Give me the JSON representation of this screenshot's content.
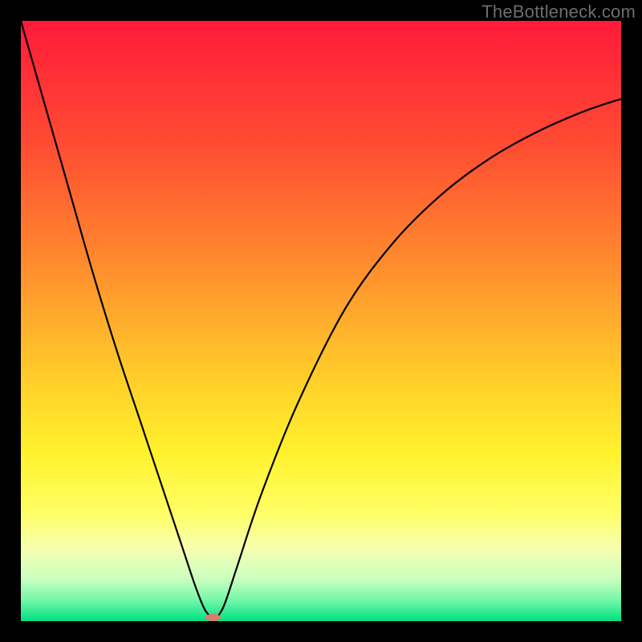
{
  "watermark": "TheBottleneck.com",
  "chart_data": {
    "type": "line",
    "title": "",
    "xlabel": "",
    "ylabel": "",
    "xlim": [
      0,
      100
    ],
    "ylim": [
      0,
      100
    ],
    "background": {
      "type": "vertical-gradient",
      "stops": [
        {
          "pos": 0.0,
          "color": "#ff1a3a"
        },
        {
          "pos": 0.2,
          "color": "#ff4a32"
        },
        {
          "pos": 0.4,
          "color": "#ff8a2e"
        },
        {
          "pos": 0.58,
          "color": "#ffc92a"
        },
        {
          "pos": 0.72,
          "color": "#fff22c"
        },
        {
          "pos": 0.82,
          "color": "#ffff66"
        },
        {
          "pos": 0.88,
          "color": "#f6ffb0"
        },
        {
          "pos": 0.93,
          "color": "#c9ffc0"
        },
        {
          "pos": 0.965,
          "color": "#74f7a8"
        },
        {
          "pos": 1.0,
          "color": "#00e082"
        }
      ]
    },
    "series": [
      {
        "name": "bottleneck-curve",
        "color": "#000000",
        "x": [
          0,
          4,
          8,
          12,
          16,
          20,
          24,
          27,
          29,
          30.5,
          31.5,
          32,
          32.8,
          34,
          36,
          40,
          46,
          54,
          62,
          70,
          78,
          86,
          94,
          100
        ],
        "y": [
          100,
          86,
          72,
          58,
          45,
          33,
          21,
          12,
          6,
          2.2,
          0.8,
          0.4,
          0.8,
          3,
          9,
          21,
          36,
          52,
          63,
          71,
          77,
          81.5,
          85,
          87
        ]
      }
    ],
    "marker": {
      "name": "optimal-point",
      "x": 32,
      "y": 0.6,
      "color": "#dd7a72",
      "rx": 1.3,
      "ry": 0.6
    }
  }
}
